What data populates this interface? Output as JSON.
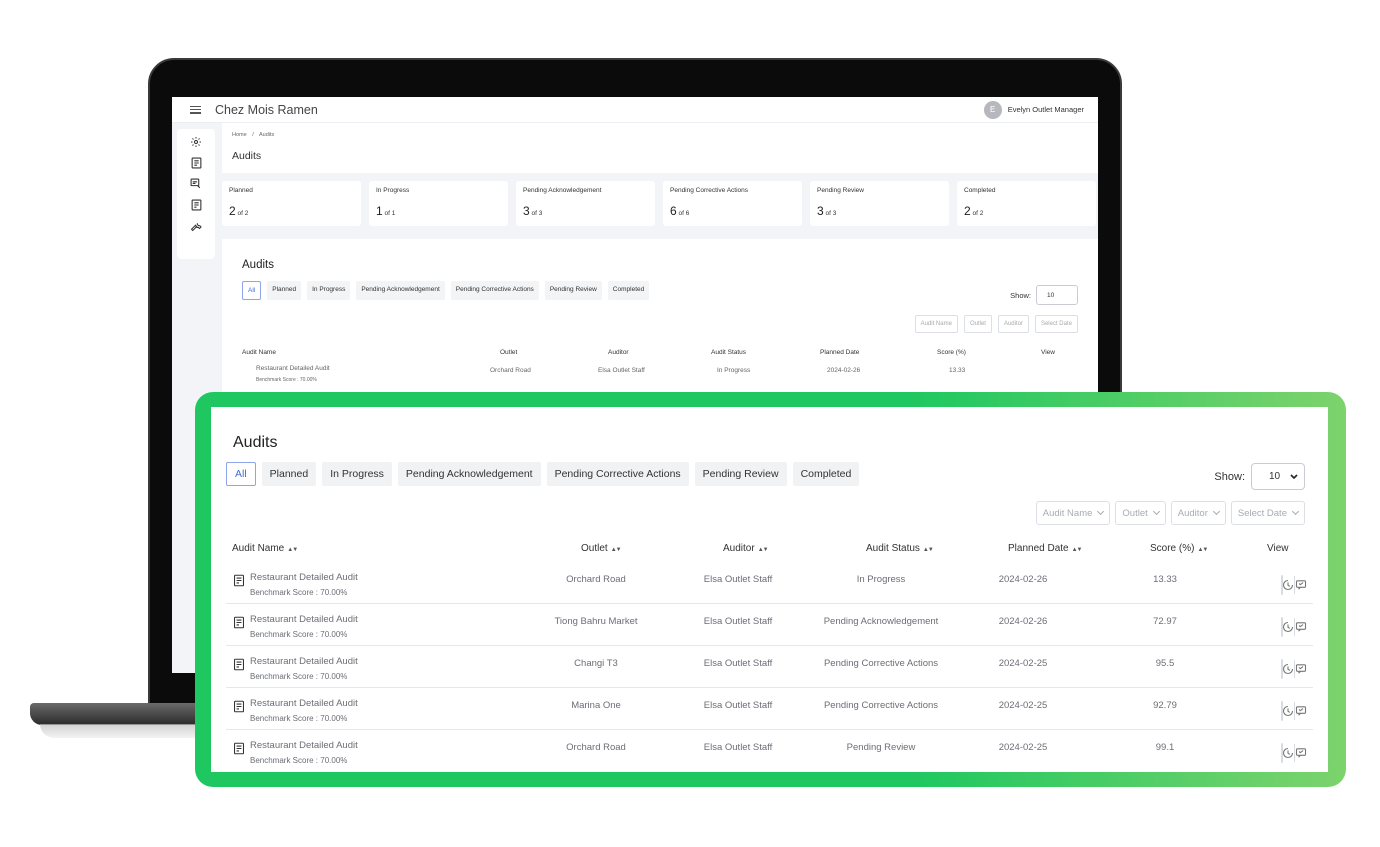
{
  "app": {
    "title": "Chez Mois Ramen"
  },
  "user": {
    "initial": "E",
    "label": "Evelyn Outlet Manager"
  },
  "breadcrumb": {
    "home": "Home",
    "separator": "/",
    "current": "Audits"
  },
  "page_title": "Audits",
  "summary_cards": [
    {
      "label": "Planned",
      "count": "2",
      "total": "of 2"
    },
    {
      "label": "In Progress",
      "count": "1",
      "total": "of 1"
    },
    {
      "label": "Pending Acknowledgement",
      "count": "3",
      "total": "of 3"
    },
    {
      "label": "Pending Corrective Actions",
      "count": "6",
      "total": "of 6"
    },
    {
      "label": "Pending Review",
      "count": "3",
      "total": "of 3"
    },
    {
      "label": "Completed",
      "count": "2",
      "total": "of 2"
    }
  ],
  "audits_panel": {
    "title": "Audits",
    "tabs": [
      "All",
      "Planned",
      "In Progress",
      "Pending Acknowledgement",
      "Pending Corrective Actions",
      "Pending Review",
      "Completed"
    ],
    "show_label": "Show:",
    "show_value": "10",
    "filters": [
      "Audit Name",
      "Outlet",
      "Auditor",
      "Select Date"
    ],
    "columns": [
      "Audit Name",
      "Outlet",
      "Auditor",
      "Audit Status",
      "Planned Date",
      "Score (%)",
      "View"
    ],
    "rows": [
      {
        "name": "Restaurant Detailed Audit",
        "benchmark": "Benchmark Score : 70.00%",
        "outlet": "Orchard Road",
        "auditor": "Elsa Outlet Staff",
        "status": "In Progress",
        "date": "2024-02-26",
        "score": "13.33"
      },
      {
        "name": "Restaurant Detailed Audit",
        "benchmark": "Benchmark Score : 70.00%",
        "outlet": "Tiong Bahru Market",
        "auditor": "Elsa Outlet Staff",
        "status": "Pending Acknowledgement",
        "date": "2024-02-26",
        "score": "72.97"
      },
      {
        "name": "Restaurant Detailed Audit",
        "benchmark": "Benchmark Score : 70.00%",
        "outlet": "Changi T3",
        "auditor": "Elsa Outlet Staff",
        "status": "Pending Corrective Actions",
        "date": "2024-02-25",
        "score": "95.5"
      },
      {
        "name": "Restaurant Detailed Audit",
        "benchmark": "Benchmark Score : 70.00%",
        "outlet": "Marina One",
        "auditor": "Elsa Outlet Staff",
        "status": "Pending Corrective Actions",
        "date": "2024-02-25",
        "score": "92.79"
      },
      {
        "name": "Restaurant Detailed Audit",
        "benchmark": "Benchmark Score : 70.00%",
        "outlet": "Orchard Road",
        "auditor": "Elsa Outlet Staff",
        "status": "Pending Review",
        "date": "2024-02-25",
        "score": "99.1"
      }
    ]
  },
  "sidebar_icons": [
    "gear-icon",
    "audit-book-icon",
    "audit-chat-icon",
    "checklist-icon",
    "wrench-icon"
  ],
  "colors": {
    "accent_green": "#1ec760",
    "accent_green_end": "#7dd36c",
    "active_tab": "#3f6fd1"
  }
}
